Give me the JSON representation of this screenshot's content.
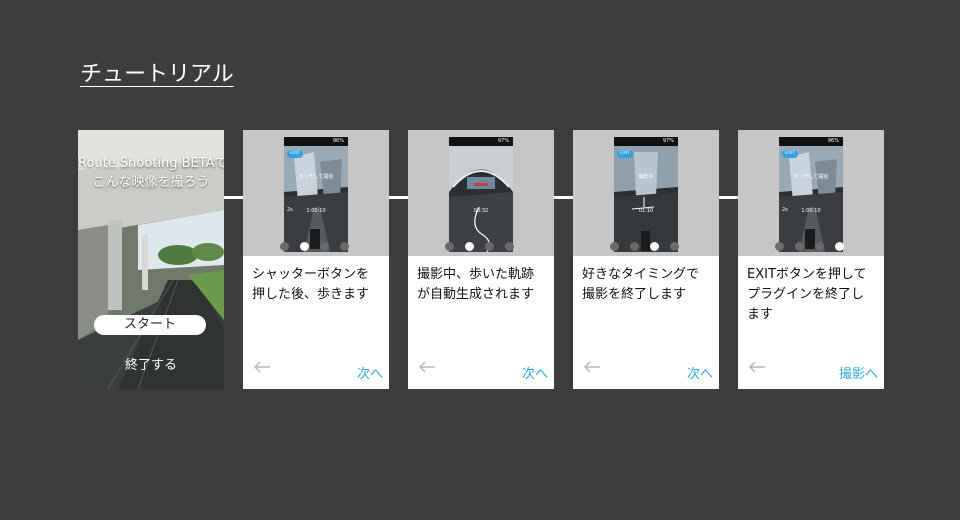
{
  "page": {
    "title": "チュートリアル"
  },
  "start_card": {
    "heading_line1": "Route Shooting BETAで",
    "heading_line2": "こんな映像を撮ろう",
    "start_button_label": "スタート",
    "quit_label": "終了する"
  },
  "steps": [
    {
      "text_line1": "シャッターボタンを",
      "text_line2": "押した後、歩きます",
      "text_line3": "",
      "next_label": "次へ",
      "active_dot": 1,
      "phone": {
        "battery": "96%",
        "exit": "EXIT",
        "caption": "タッチして開始",
        "time": "1:00:10",
        "timer": "2s"
      }
    },
    {
      "text_line1": "撮影中、歩いた軌跡",
      "text_line2": "が自動生成されます",
      "text_line3": "",
      "next_label": "次へ",
      "active_dot": 2,
      "phone": {
        "battery": "97%",
        "exit": "",
        "caption": "",
        "time": "00:32",
        "timer": ""
      }
    },
    {
      "text_line1": "好きなタイミングで",
      "text_line2": "撮影を終了します",
      "text_line3": "",
      "next_label": "次へ",
      "active_dot": 3,
      "phone": {
        "battery": "97%",
        "exit": "EXIT",
        "caption": "撮影中",
        "time": "01:10",
        "timer": ""
      }
    },
    {
      "text_line1": "EXITボタンを押して",
      "text_line2": "プラグインを終了し",
      "text_line3": "ます",
      "next_label": "撮影へ",
      "active_dot": 4,
      "phone": {
        "battery": "96%",
        "exit": "EXIT",
        "caption": "タッチして開始",
        "time": "1:00:10",
        "timer": "2s"
      }
    }
  ],
  "colors": {
    "background": "#3d3d3d",
    "accent": "#29a9e0",
    "exit_chip": "#2ea3e6"
  },
  "icons": {
    "back": "arrow-left-icon"
  }
}
